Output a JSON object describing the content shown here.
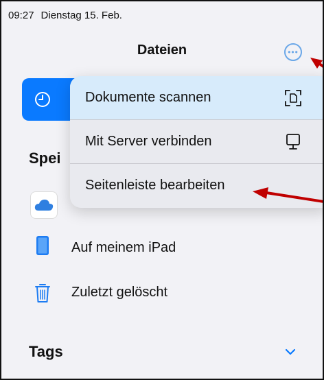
{
  "status_bar": {
    "time": "09:27",
    "date": "Dienstag 15. Feb."
  },
  "nav": {
    "title": "Dateien",
    "more_icon": "ellipsis-circle-icon"
  },
  "sidebar": {
    "section_label": "Spei",
    "items": [
      {
        "label": "Auf meinem iPad",
        "icon": "ipad-icon"
      },
      {
        "label": "Zuletzt gelöscht",
        "icon": "trash-icon"
      }
    ],
    "tags_label": "Tags"
  },
  "menu": {
    "items": [
      {
        "label": "Dokumente scannen",
        "icon": "doc-scan-icon"
      },
      {
        "label": "Mit Server verbinden",
        "icon": "display-icon"
      },
      {
        "label": "Seitenleiste bearbeiten",
        "icon": ""
      }
    ]
  },
  "colors": {
    "accent": "#0a7aff",
    "annotation_arrow": "#c00000"
  }
}
